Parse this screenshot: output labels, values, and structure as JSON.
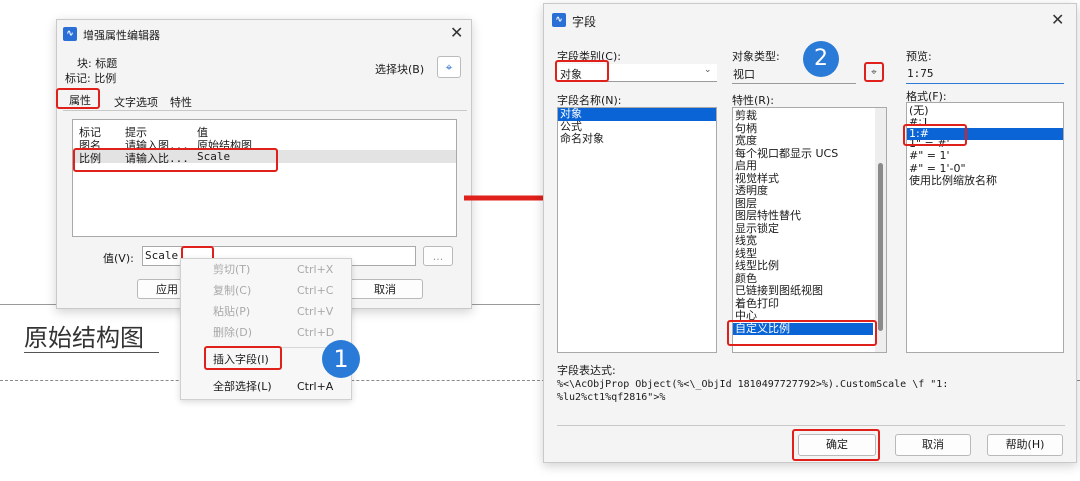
{
  "left_dialog": {
    "title": "增强属性编辑器",
    "block_line": "块: 标题",
    "tag_line": "标记: 比例",
    "select_block_label": "选择块(B)",
    "tabs": [
      "属性",
      "文字选项",
      "特性"
    ],
    "table_headers": [
      "标记",
      "提示",
      "值"
    ],
    "rows": [
      {
        "tag": "图名",
        "prompt": "请输入图...",
        "value": "原始结构图"
      },
      {
        "tag": "比例",
        "prompt": "请输入比...",
        "value": "Scale"
      }
    ],
    "value_label": "值(V):",
    "value_text": "Scale",
    "ellipsis": "...",
    "apply_label": "应用",
    "cancel_label": "取消"
  },
  "context_menu": {
    "items": [
      {
        "label": "剪切(T)",
        "shortcut": "Ctrl+X",
        "enabled": false
      },
      {
        "label": "复制(C)",
        "shortcut": "Ctrl+C",
        "enabled": false
      },
      {
        "label": "粘贴(P)",
        "shortcut": "Ctrl+V",
        "enabled": false
      },
      {
        "label": "删除(D)",
        "shortcut": "Ctrl+D",
        "enabled": false
      },
      {
        "label": "插入字段(I)",
        "shortcut": "",
        "enabled": true
      },
      {
        "label": "全部选择(L)",
        "shortcut": "Ctrl+A",
        "enabled": true
      }
    ]
  },
  "background": {
    "drawing_text": "原始结构图"
  },
  "steps": {
    "step1": "1",
    "step2": "2"
  },
  "right_dialog": {
    "title": "字段",
    "field_category_label": "字段类别(C):",
    "field_category_value": "对象",
    "object_type_label": "对象类型:",
    "object_type_value": "视口",
    "preview_label": "预览:",
    "preview_value": "1:75",
    "field_names_label": "字段名称(N):",
    "field_names": [
      "对象",
      "公式",
      "命名对象"
    ],
    "properties_label": "特性(R):",
    "properties": [
      "剪裁",
      "句柄",
      "宽度",
      "每个视口都显示 UCS",
      "启用",
      "视觉样式",
      "透明度",
      "图层",
      "图层特性替代",
      "显示锁定",
      "线宽",
      "线型",
      "线型比例",
      "颜色",
      "已链接到图纸视图",
      "着色打印",
      "中心",
      "自定义比例"
    ],
    "format_label": "格式(F):",
    "formats": [
      "(无)",
      "#:1",
      "1:#",
      "1\" = #'",
      "#\" = 1'",
      "#\" = 1'-0\"",
      "使用比例缩放名称"
    ],
    "expression_label": "字段表达式:",
    "expression_line1": "%<\\AcObjProp Object(%<\\_ObjId 1810497727792>%).CustomScale \\f \"1:",
    "expression_line2": "%lu2%ct1%qf2816\">%",
    "ok_label": "确定",
    "cancel_label": "取消",
    "help_label": "帮助(H)"
  },
  "colors": {
    "highlight_red": "#e0201b",
    "selection_blue": "#0a64d6",
    "step_badge_blue": "#2a7bd8"
  }
}
